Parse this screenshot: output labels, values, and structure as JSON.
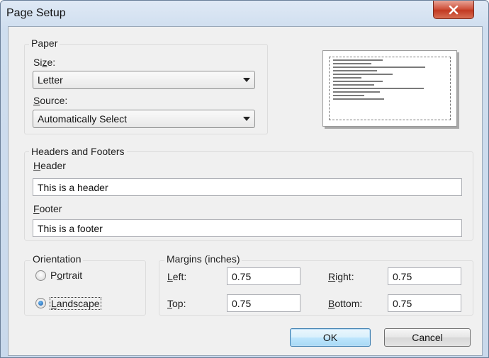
{
  "window": {
    "title": "Page Setup",
    "close_icon": "close-icon"
  },
  "paper": {
    "legend": "Paper",
    "size_label": "Size:",
    "size_value": "Letter",
    "source_label": "Source:",
    "source_value": "Automatically Select"
  },
  "headers_footers": {
    "legend": "Headers and Footers",
    "header_label": "Header",
    "header_value": "This is a header",
    "footer_label": "Footer",
    "footer_value": "This is a footer"
  },
  "orientation": {
    "legend": "Orientation",
    "portrait_label": "Portrait",
    "landscape_label": "Landscape",
    "selected": "Landscape"
  },
  "margins": {
    "legend": "Margins (inches)",
    "left_label": "Left:",
    "left_value": "0.75",
    "right_label": "Right:",
    "right_value": "0.75",
    "top_label": "Top:",
    "top_value": "0.75",
    "bottom_label": "Bottom:",
    "bottom_value": "0.75"
  },
  "buttons": {
    "ok": "OK",
    "cancel": "Cancel"
  }
}
